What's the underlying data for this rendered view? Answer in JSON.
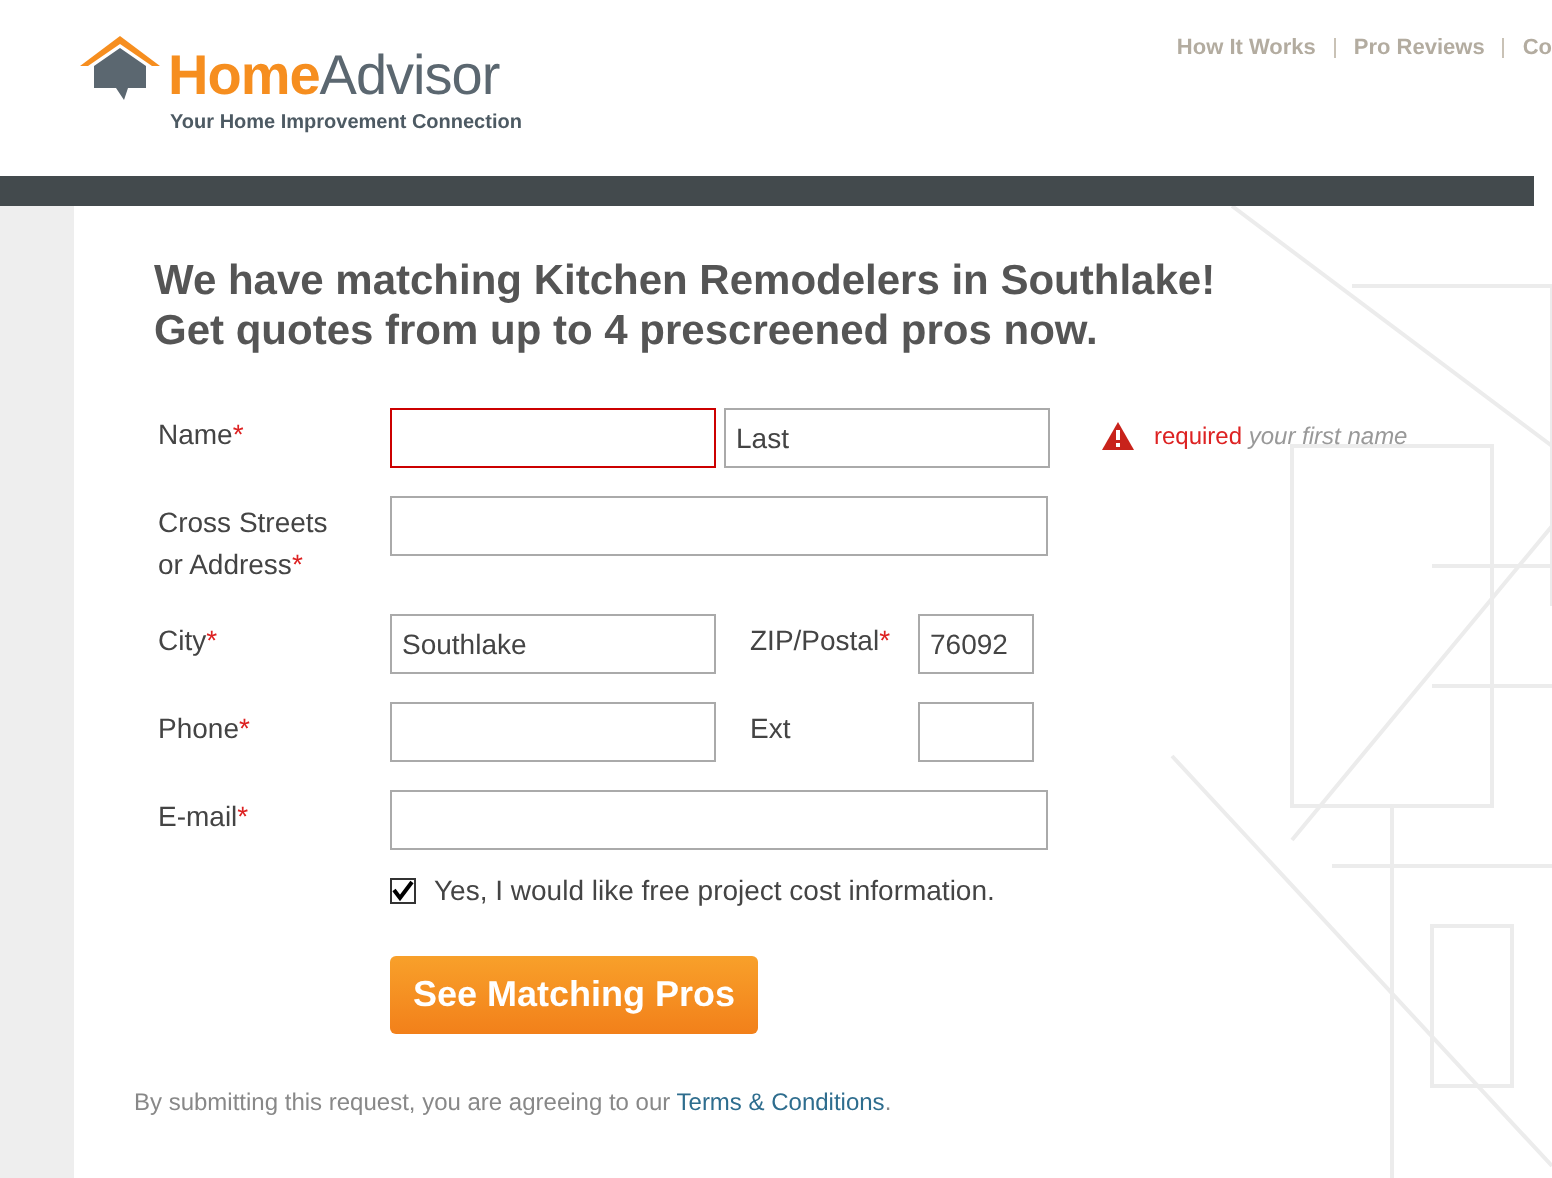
{
  "logo": {
    "word_1": "Home",
    "word_2": "Advisor",
    "tagline": "Your Home Improvement Connection"
  },
  "nav": [
    {
      "label": "How It Works"
    },
    {
      "label": "Pro Reviews"
    },
    {
      "label": "Co"
    }
  ],
  "heading": [
    "We have matching Kitchen Remodelers in Southlake!",
    "Get quotes from up to 4 prescreened pros now."
  ],
  "form": {
    "rows": [
      {
        "label": "Name",
        "mark": "*",
        "fields": [
          {
            "error": true
          },
          {
            "placeholder": "Last",
            "error": false
          }
        ],
        "message": {
          "word": "required",
          "hint": "your first name"
        }
      },
      {
        "label": "Cross Streets or Address",
        "mark": "*",
        "fields": [
          {
            "error": false
          }
        ]
      },
      {
        "label": "City",
        "mark": "*",
        "fields": [
          {
            "value": "Southlake",
            "error": false
          },
          {
            "label": "ZIP/Postal",
            "mark": "*",
            "value": "76092",
            "error": false
          }
        ]
      },
      {
        "label": "Phone",
        "mark": "*",
        "fields": [
          {
            "error": false
          },
          {
            "label": "Ext",
            "error": false
          }
        ]
      },
      {
        "label": "E-mail",
        "mark": "*",
        "fields": [
          {
            "error": false
          }
        ]
      }
    ],
    "consent": {
      "label": "Yes, I would like free project cost information.",
      "checked": true
    },
    "submit": "See Matching Pros"
  },
  "footer": {
    "text": "By submitting this request, you are agreeing to our",
    "link": "Terms & Conditions",
    "end": "."
  }
}
